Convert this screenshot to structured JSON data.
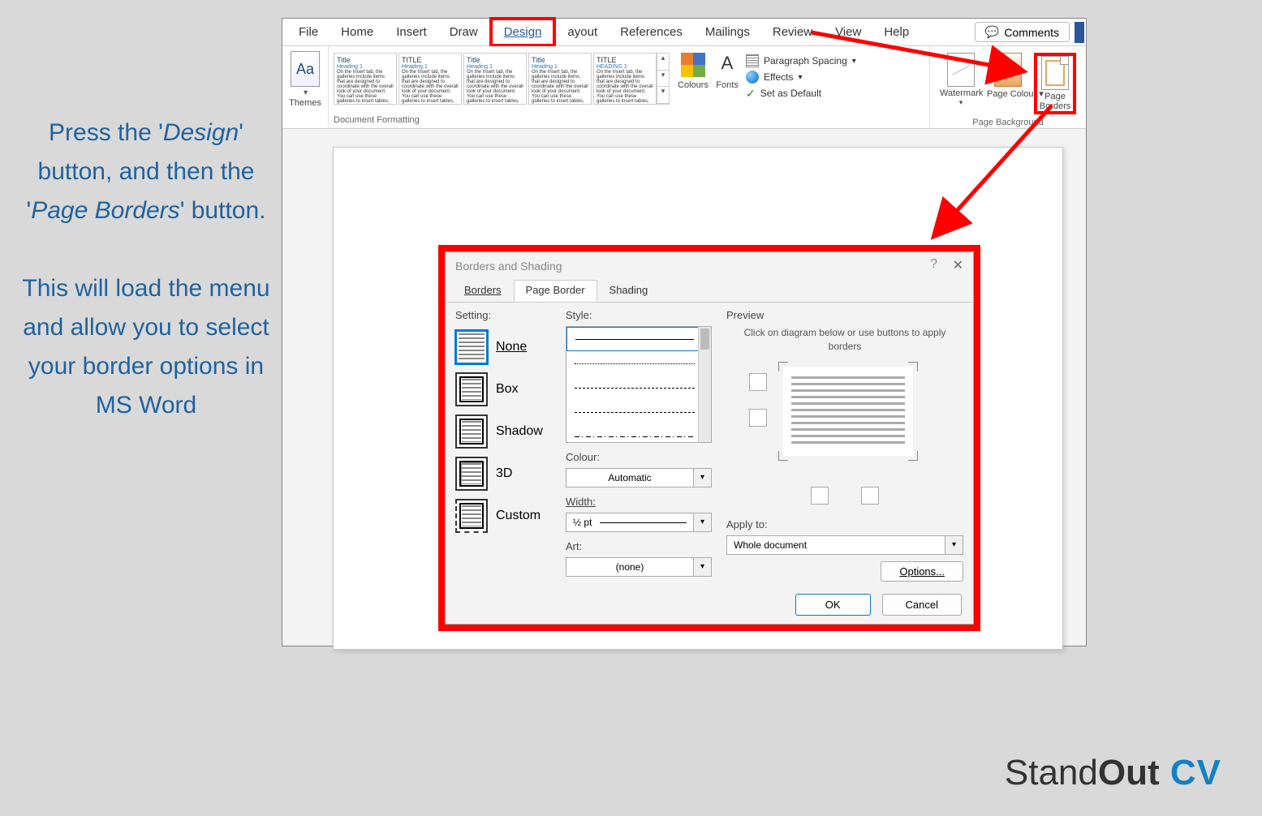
{
  "instructions": {
    "p1_a": "Press the '",
    "p1_b": "Design",
    "p1_c": "' button, and then the '",
    "p1_d": "Page Borders",
    "p1_e": "' button.",
    "p2": "This will load the menu and allow you to select your border options in MS Word"
  },
  "ribbonTabs": {
    "file": "File",
    "home": "Home",
    "insert": "Insert",
    "draw": "Draw",
    "design": "Design",
    "layout": "ayout",
    "references": "References",
    "mailings": "Mailings",
    "review": "Review",
    "view": "View",
    "help": "Help",
    "comments": "Comments"
  },
  "ribbon": {
    "themes": "Themes",
    "themesIcon": "Aa",
    "gallery": {
      "title": "Title",
      "titleCaps": "TITLE",
      "heading": "Heading 1",
      "headingCaps": "HEADING 1",
      "lorem": "On the Insert tab, the galleries include items that are designed to coordinate with the overall look of your document. You can use these galleries to insert tables, headers, footers, lists, cover pages."
    },
    "colours": "Colours",
    "fonts": "Fonts",
    "fontsIcon": "A",
    "paragraphSpacing": "Paragraph Spacing",
    "effects": "Effects",
    "setDefault": "Set as Default",
    "docFormattingLabel": "Document Formatting",
    "watermark": "Watermark",
    "pageColour": "Page Colour",
    "pageBorders": "Page Borders",
    "pageBgLabel": "Page Background"
  },
  "dialog": {
    "title": "Borders and Shading",
    "help": "?",
    "close": "✕",
    "tabs": {
      "borders": "Borders",
      "pageBorder": "Page Border",
      "shading": "Shading"
    },
    "settingLabel": "Setting:",
    "settings": {
      "none": "None",
      "box": "Box",
      "shadow": "Shadow",
      "threeD": "3D",
      "custom": "Custom"
    },
    "styleLabel": "Style:",
    "colourLabel": "Colour:",
    "colourValue": "Automatic",
    "widthLabel": "Width:",
    "widthValue": "½ pt",
    "artLabel": "Art:",
    "artValue": "(none)",
    "previewLabel": "Preview",
    "previewHint": "Click on diagram below or use buttons to apply borders",
    "applyToLabel": "Apply to:",
    "applyToValue": "Whole document",
    "optionsBtn": "Options...",
    "ok": "OK",
    "cancel": "Cancel"
  },
  "brand": {
    "a": "Stand",
    "b": "Out",
    "c": " CV"
  }
}
